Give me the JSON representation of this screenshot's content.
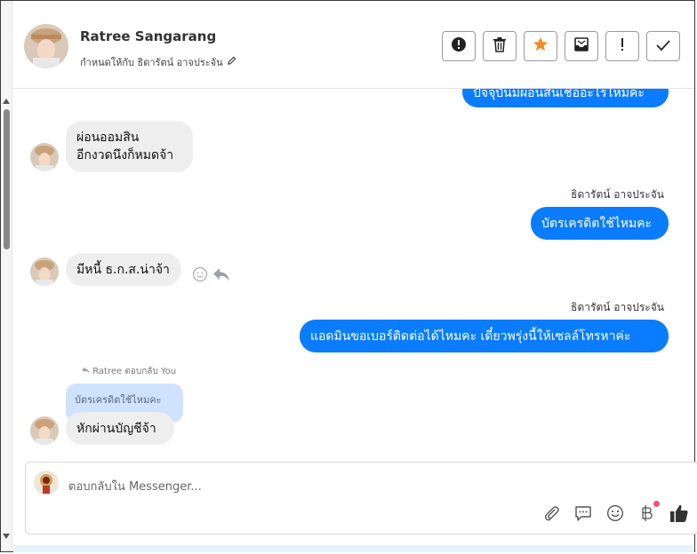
{
  "contact": {
    "name": "Ratree Sangarang",
    "assigned_to": "กำหนดให้กับ ธิดารัตน์ อาจประจัน"
  },
  "toolbar": {
    "icons": [
      "alert-circle-icon",
      "trash-icon",
      "star-icon",
      "archive-icon",
      "exclamation-icon",
      "check-icon"
    ],
    "star_color": "#f28c28"
  },
  "messages": {
    "m0_partial": "ปัจจุบันมีผ่อนสินเชื่ออะไรไหมคะ",
    "m1_line1": "ผ่อนออมสิน",
    "m1_line2": "อีกงวดนึงก็หมดจ้า",
    "m2_sender": "ธิดารัตน์ อาจประจัน",
    "m2_text": "บัตรเครดิตใช้ไหมคะ",
    "m3_text": "มีหนี้ ธ.ก.ส.น่าจ้า",
    "m4_sender": "ธิดารัตน์ อาจประจัน",
    "m4_text": "แอดมินขอเบอร์ติดต่อได้ไหมคะ เดี๋ยวพรุ่งนี้ให้เซลล์โทรหาค่ะ",
    "m5_replied_label": "Ratree ตอบกลับ You",
    "m5_quote": "บัตรเครดิตใช้ไหมคะ",
    "m5_text": "หักผ่านบัญชีจ้า"
  },
  "composer": {
    "placeholder": "ตอบกลับใน Messenger...",
    "icons": [
      "attachment-icon",
      "saved-reply-icon",
      "emoji-icon",
      "baht-icon",
      "like-icon"
    ]
  },
  "colors": {
    "outgoing_bubble": "#0a7cff",
    "incoming_bubble": "#eeeeee",
    "quote_bubble": "#cfe3ff"
  }
}
